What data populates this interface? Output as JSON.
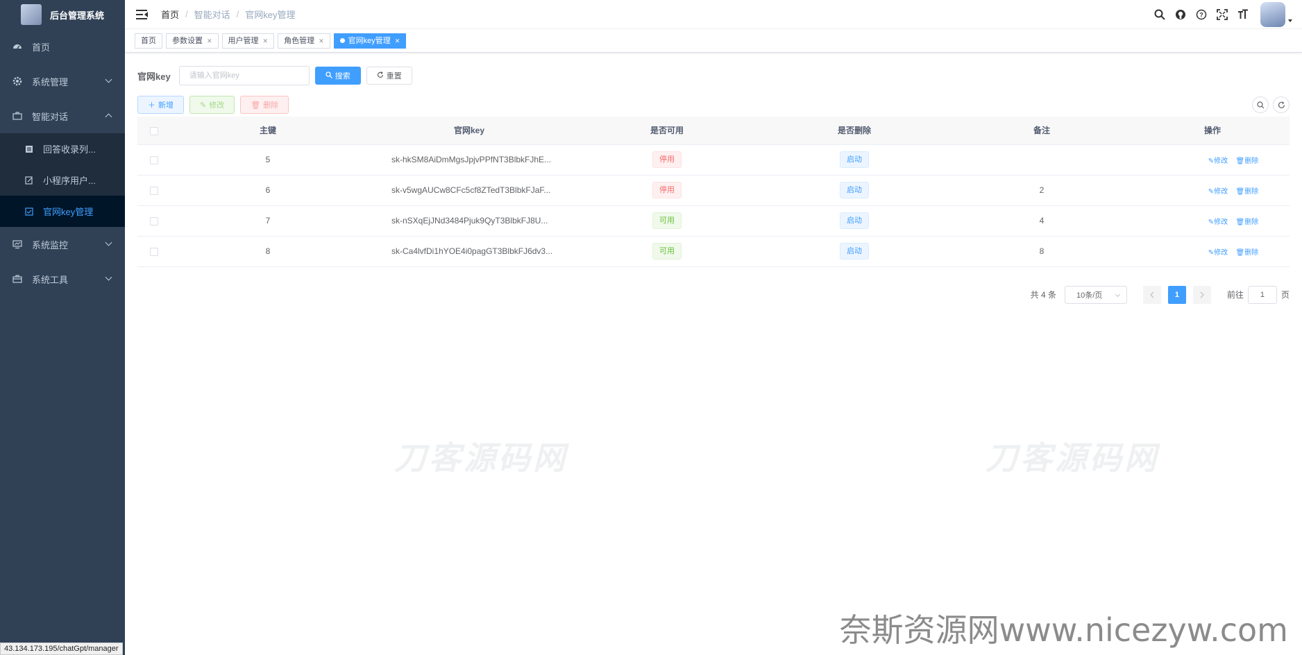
{
  "app": {
    "title": "后台管理系统"
  },
  "sidebar": {
    "items": [
      {
        "label": "首页",
        "icon": "dashboard-icon"
      },
      {
        "label": "系统管理",
        "icon": "gear-icon"
      },
      {
        "label": "智能对话",
        "icon": "briefcase-icon",
        "children": [
          {
            "label": "回答收录列...",
            "icon": "list-icon"
          },
          {
            "label": "小程序用户...",
            "icon": "edit-icon"
          },
          {
            "label": "官网key管理",
            "icon": "checkbox-icon"
          }
        ]
      },
      {
        "label": "系统监控",
        "icon": "monitor-icon"
      },
      {
        "label": "系统工具",
        "icon": "toolbox-icon"
      }
    ]
  },
  "breadcrumb": [
    "首页",
    "智能对话",
    "官网key管理"
  ],
  "tags": [
    {
      "label": "首页"
    },
    {
      "label": "参数设置"
    },
    {
      "label": "用户管理"
    },
    {
      "label": "角色管理"
    },
    {
      "label": "官网key管理"
    }
  ],
  "search": {
    "label": "官网key",
    "placeholder": "请输入官网key",
    "search_btn": "搜索",
    "reset_btn": "重置"
  },
  "toolbar": {
    "add": "新增",
    "edit": "修改",
    "delete": "删除"
  },
  "table": {
    "headers": [
      "主键",
      "官网key",
      "是否可用",
      "是否删除",
      "备注",
      "操作"
    ],
    "rows": [
      {
        "id": "5",
        "key": "sk-hkSM8AiDmMgsJpjvPPfNT3BlbkFJhE...",
        "usable": "停用",
        "deleted": "启动",
        "remark": ""
      },
      {
        "id": "6",
        "key": "sk-v5wgAUCw8CFc5cf8ZTedT3BlbkFJaF...",
        "usable": "停用",
        "deleted": "启动",
        "remark": "2"
      },
      {
        "id": "7",
        "key": "sk-nSXqEjJNd3484Pjuk9QyT3BlbkFJ8U...",
        "usable": "可用",
        "deleted": "启动",
        "remark": "4"
      },
      {
        "id": "8",
        "key": "sk-Ca4lvfDi1hYOE4i0pagGT3BlbkFJ6dv3...",
        "usable": "可用",
        "deleted": "启动",
        "remark": "8"
      }
    ],
    "op_edit": "修改",
    "op_delete": "删除"
  },
  "pagination": {
    "total": "共 4 条",
    "page_size": "10条/页",
    "current": "1",
    "goto_prefix": "前往",
    "goto_value": "1",
    "goto_suffix": "页"
  },
  "watermarks": {
    "center": "刀客源码网",
    "bottom": "奈斯资源网www.nicezyw.com"
  },
  "status_url": "43.134.173.195/chatGpt/manager",
  "colors": {
    "sidebar_bg": "#304156",
    "primary": "#409eff",
    "danger": "#f56c6c",
    "success": "#67c23a"
  }
}
